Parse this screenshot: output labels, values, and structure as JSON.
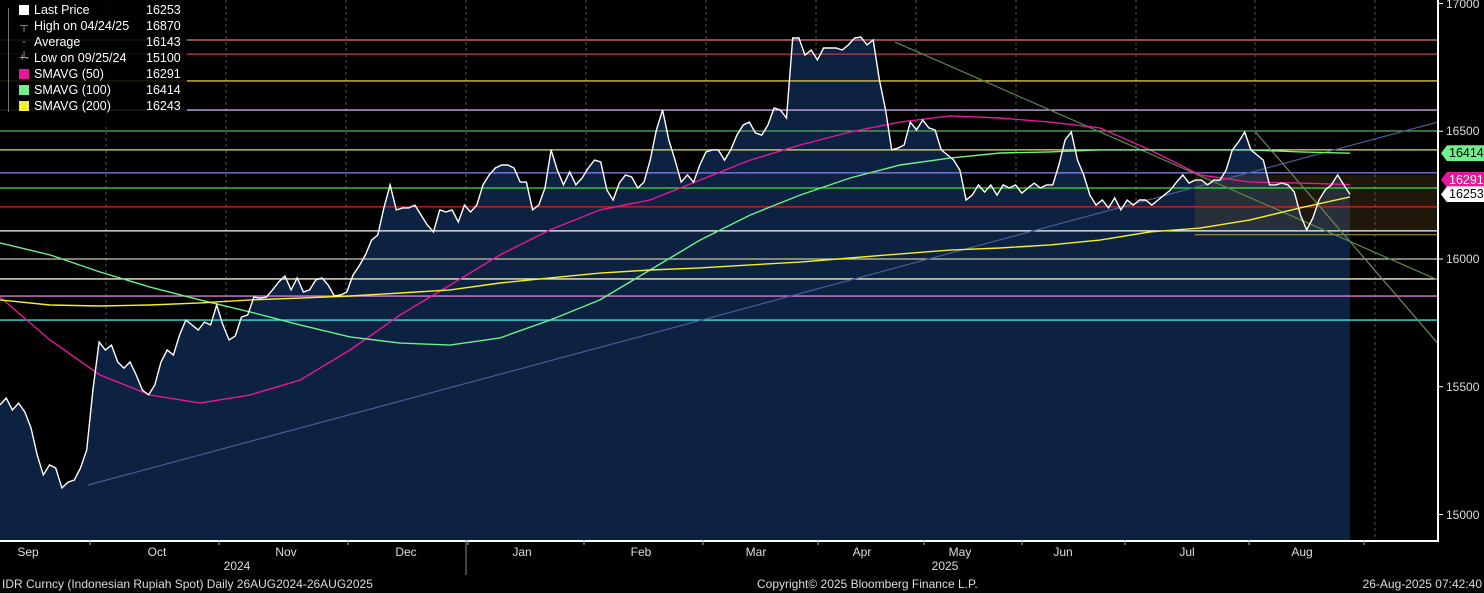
{
  "legend": {
    "items": [
      {
        "label": "Last Price",
        "value": "16253",
        "color": "#ffffff",
        "icon": "square"
      },
      {
        "label": "High on 04/24/25",
        "value": "16870",
        "icon": "high-marker-icon"
      },
      {
        "label": "Average",
        "value": "16143",
        "icon": "average-marker-icon"
      },
      {
        "label": "Low on 09/25/24",
        "value": "15100",
        "icon": "low-marker-icon"
      },
      {
        "label": "SMAVG (50)",
        "value": "16291",
        "color": "#e8179a",
        "icon": "square"
      },
      {
        "label": "SMAVG (100)",
        "value": "16414",
        "color": "#6ef08c",
        "icon": "square"
      },
      {
        "label": "SMAVG (200)",
        "value": "16243",
        "color": "#f5f021",
        "icon": "square"
      }
    ]
  },
  "badges": [
    {
      "value": "16414",
      "bg": "#6ef08c",
      "fg": "#000000",
      "at": 16414
    },
    {
      "value": "16291",
      "bg": "#e8179a",
      "fg": "#ffffff",
      "at": 16310
    },
    {
      "value": "16253",
      "bg": "#ffffff",
      "fg": "#000000",
      "at": 16253
    }
  ],
  "footer": {
    "left": "IDR Curncy (Indonesian Rupiah Spot)  Daily 26AUG2024-26AUG2025",
    "center": "Copyright© 2025 Bloomberg Finance L.P.",
    "right": "26-Aug-2025 07:42:40"
  },
  "chart_data": {
    "type": "line",
    "title": "IDR Curncy (Indonesian Rupiah Spot)",
    "range": "26AUG2024-26AUG2025",
    "ylim": [
      14900,
      17030
    ],
    "yticks": [
      "17000",
      "16500",
      "16000",
      "15500",
      "15000"
    ],
    "months": [
      "Sep",
      "Oct",
      "Nov",
      "Dec",
      "Jan",
      "Feb",
      "Mar",
      "Apr",
      "May",
      "Jun",
      "Jul",
      "Aug"
    ],
    "years": [
      "2024",
      "2025"
    ],
    "series": [
      {
        "name": "Last Price",
        "color": "#ffffff",
        "fill": "#0c2240",
        "values": [
          15429,
          15456,
          15409,
          15436,
          15401,
          15339,
          15233,
          15155,
          15194,
          15182,
          15104,
          15127,
          15135,
          15182,
          15252,
          15487,
          15675,
          15644,
          15663,
          15597,
          15573,
          15597,
          15546,
          15487,
          15468,
          15507,
          15597,
          15644,
          15624,
          15703,
          15761,
          15742,
          15722,
          15753,
          15742,
          15820,
          15742,
          15683,
          15699,
          15773,
          15781,
          15851,
          15847,
          15851,
          15879,
          15910,
          15933,
          15879,
          15926,
          15871,
          15879,
          15918,
          15926,
          15898,
          15855,
          15859,
          15871,
          15937,
          15973,
          16016,
          16074,
          16094,
          16200,
          16290,
          16192,
          16200,
          16200,
          16211,
          16172,
          16133,
          16106,
          16192,
          16184,
          16192,
          16145,
          16211,
          16184,
          16211,
          16290,
          16329,
          16356,
          16368,
          16368,
          16356,
          16301,
          16301,
          16192,
          16211,
          16278,
          16427,
          16348,
          16290,
          16341,
          16290,
          16317,
          16356,
          16387,
          16380,
          16270,
          16231,
          16297,
          16329,
          16321,
          16278,
          16301,
          16387,
          16505,
          16583,
          16466,
          16387,
          16301,
          16329,
          16301,
          16368,
          16419,
          16427,
          16427,
          16387,
          16427,
          16485,
          16524,
          16536,
          16493,
          16485,
          16524,
          16591,
          16583,
          16552,
          16865,
          16865,
          16798,
          16818,
          16779,
          16826,
          16826,
          16826,
          16818,
          16838,
          16865,
          16869,
          16838,
          16857,
          16701,
          16583,
          16427,
          16434,
          16446,
          16536,
          16505,
          16544,
          16513,
          16505,
          16427,
          16407,
          16387,
          16348,
          16231,
          16250,
          16290,
          16262,
          16290,
          16250,
          16290,
          16278,
          16290,
          16258,
          16278,
          16297,
          16278,
          16290,
          16290,
          16368,
          16466,
          16497,
          16387,
          16329,
          16250,
          16211,
          16231,
          16200,
          16239,
          16192,
          16231,
          16211,
          16231,
          16231,
          16211,
          16231,
          16250,
          16270,
          16301,
          16329,
          16297,
          16309,
          16309,
          16290,
          16309,
          16309,
          16348,
          16427,
          16458,
          16497,
          16427,
          16407,
          16387,
          16290,
          16290,
          16297,
          16290,
          16262,
          16172,
          16114,
          16160,
          16231,
          16270,
          16290,
          16329,
          16290,
          16253
        ]
      },
      {
        "name": "SMAVG (50)",
        "color": "#e8179a",
        "values": [
          15851,
          15683,
          15546,
          15468,
          15436,
          15468,
          15526,
          15644,
          15781,
          15898,
          16016,
          16114,
          16192,
          16231,
          16309,
          16387,
          16446,
          16497,
          16536,
          16560,
          16552,
          16536,
          16513,
          16427,
          16329,
          16301,
          16297,
          16291
        ]
      },
      {
        "name": "SMAVG (100)",
        "color": "#6ef08c",
        "values": [
          16063,
          16016,
          15949,
          15890,
          15840,
          15793,
          15742,
          15695,
          15671,
          15663,
          15691,
          15761,
          15840,
          15957,
          16074,
          16172,
          16250,
          16317,
          16368,
          16395,
          16415,
          16419,
          16427,
          16427,
          16427,
          16427,
          16419,
          16414
        ]
      },
      {
        "name": "SMAVG (200)",
        "color": "#f5f021",
        "values": [
          15840,
          15820,
          15816,
          15820,
          15828,
          15840,
          15847,
          15855,
          15867,
          15879,
          15906,
          15926,
          15945,
          15957,
          15965,
          15977,
          15988,
          16004,
          16020,
          16035,
          16043,
          16055,
          16074,
          16106,
          16121,
          16153,
          16200,
          16243
        ]
      }
    ],
    "levels": [
      {
        "value": 16857,
        "color": "#e07a8a"
      },
      {
        "value": 16802,
        "color": "#c04048"
      },
      {
        "value": 16697,
        "color": "#e0c040"
      },
      {
        "value": 16583,
        "color": "#c8a8e8"
      },
      {
        "value": 16501,
        "color": "#60b060"
      },
      {
        "value": 16427,
        "color": "#e8e840"
      },
      {
        "value": 16337,
        "color": "#8888e8"
      },
      {
        "value": 16278,
        "color": "#40e040"
      },
      {
        "value": 16204,
        "color": "#e02020"
      },
      {
        "value": 16110,
        "color": "#ffffff"
      },
      {
        "value": 16000,
        "color": "#c8c8a8"
      },
      {
        "value": 15922,
        "color": "#f0f0c8"
      },
      {
        "value": 15855,
        "color": "#d080d0"
      },
      {
        "value": 15761,
        "color": "#40e0e0"
      }
    ],
    "trendlines": [
      {
        "name": "uptrend",
        "color": "#4a5a9a",
        "from": [
          0.065,
          15115
        ],
        "to": [
          1.065,
          16536
        ]
      },
      {
        "name": "downtrend",
        "color": "#5a8a4a",
        "from": [
          0.663,
          16849
        ],
        "to": [
          1.065,
          15918
        ]
      },
      {
        "name": "steep-downtrend",
        "color": "#6a8a5a",
        "from": [
          0.93,
          16497
        ],
        "to": [
          1.065,
          15670
        ]
      }
    ]
  }
}
